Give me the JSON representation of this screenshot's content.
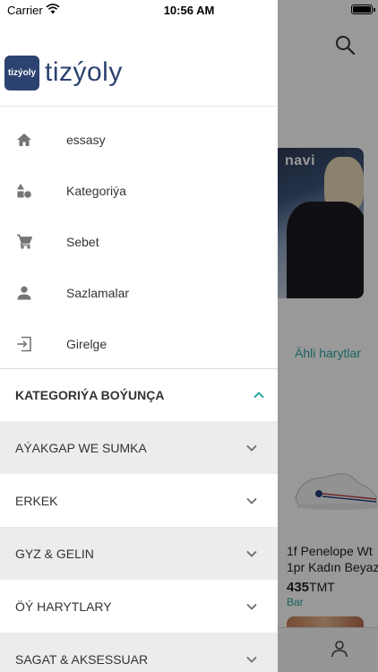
{
  "status_bar": {
    "carrier": "Carrier",
    "time": "10:56 AM"
  },
  "background": {
    "banner_brand": "navi",
    "all_cards_link": "Ähli harytlar",
    "product_name_line1": "1f Penelope Wt",
    "product_name_line2": "1pr Kadın Beyaz",
    "price_value": "435",
    "price_currency": "TMT",
    "seller": "Bar"
  },
  "drawer": {
    "logo_badge": "tizýoly",
    "logo_text": "tizýoly",
    "menu": [
      {
        "icon": "home-icon",
        "label": "essasy"
      },
      {
        "icon": "category-icon",
        "label": "Kategoriýa"
      },
      {
        "icon": "cart-icon",
        "label": "Sebet"
      },
      {
        "icon": "person-icon",
        "label": "Sazlamalar"
      },
      {
        "icon": "login-icon",
        "label": "Girelge"
      }
    ],
    "category_section": {
      "title": "KATEGORIÝA BOÝUNÇA",
      "expanded": true
    },
    "categories": [
      {
        "label": "AÝAKGAP WE SUMKA"
      },
      {
        "label": "ERKEK"
      },
      {
        "label": "GYZ & GELIN"
      },
      {
        "label": "ÖÝ HARYTLARY"
      },
      {
        "label": "SAGAT & AKSESSUAR"
      }
    ]
  },
  "colors": {
    "brand": "#2c4270",
    "accent": "#2ba6a0",
    "icon_gray": "#757575"
  }
}
